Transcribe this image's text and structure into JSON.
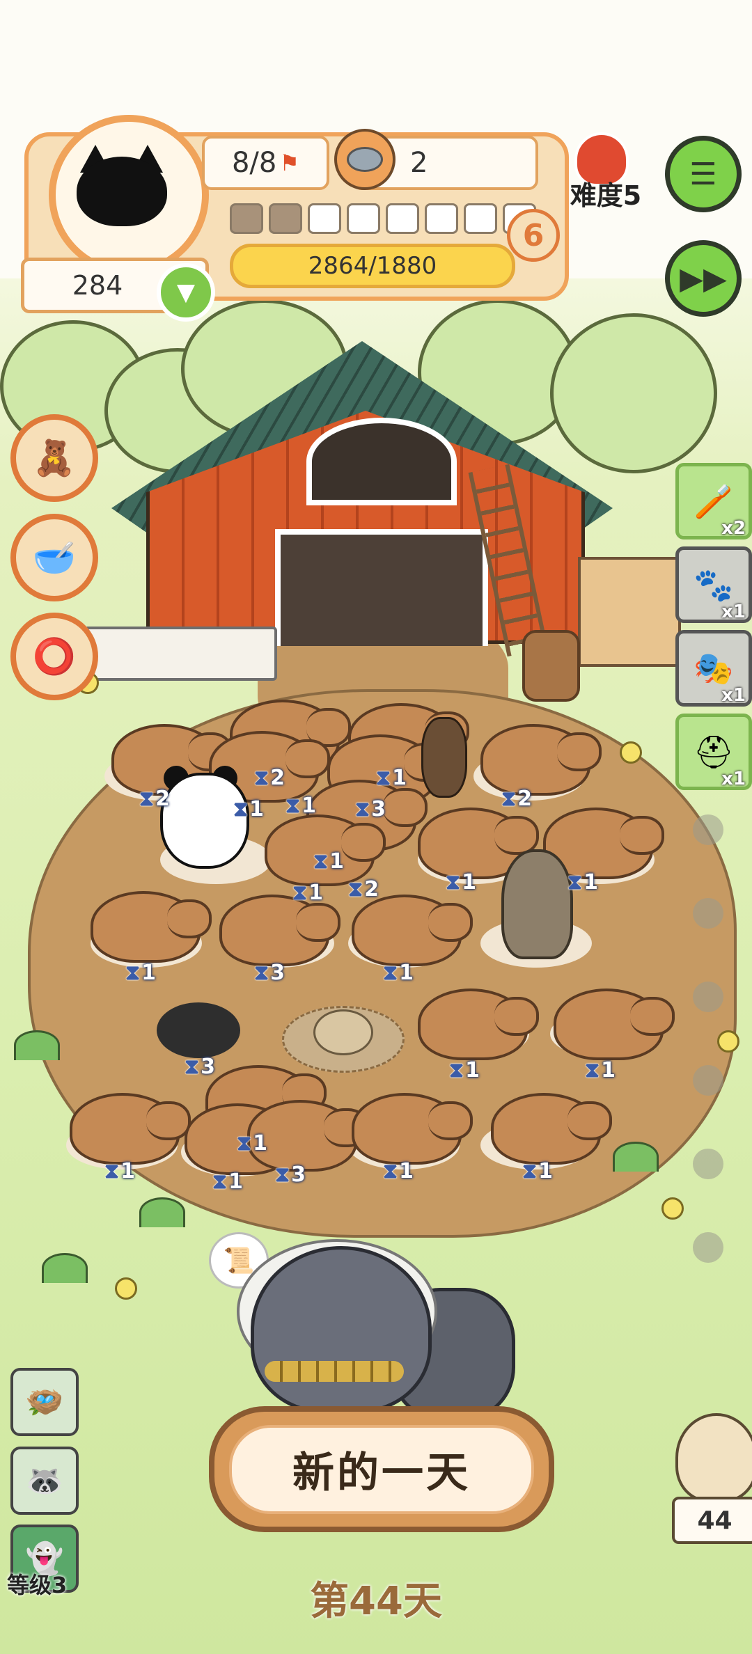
{
  "hud": {
    "flags": "8/8",
    "food_bowls": "2",
    "coins": "284",
    "level": "6",
    "xp": "2864/1880",
    "segments_filled": 2,
    "segments_total": 8,
    "difficulty": "难度5"
  },
  "buttons": {
    "menu_icon": "list-icon",
    "fast_forward_icon": "fast-forward-icon"
  },
  "items": [
    {
      "name": "brush",
      "count": "x2"
    },
    {
      "name": "cat-food-bag",
      "count": "x1"
    },
    {
      "name": "bird-mask",
      "count": "x1"
    },
    {
      "name": "green-hat",
      "count": "x1"
    }
  ],
  "timers": [
    "2",
    "2",
    "1",
    "1",
    "1",
    "3",
    "2",
    "1",
    "1",
    "2",
    "1",
    "1",
    "3",
    "1",
    "3",
    "1",
    "1",
    "1",
    "1",
    "3",
    "1",
    "1",
    "1"
  ],
  "new_day": "新的一天",
  "day_label": "第44天",
  "level_label": "等级3",
  "owl_count": "44"
}
